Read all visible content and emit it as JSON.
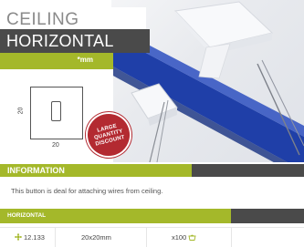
{
  "header": {
    "title_line1": "CEILING",
    "title_line2": "HORIZONTAL CLIP"
  },
  "dimensions": {
    "unit_label": "*mm",
    "height_label": "20",
    "width_label": "20"
  },
  "badge": {
    "line1": "LARGE",
    "line2": "QUANTITY",
    "line3": "DISCOUNT"
  },
  "info": {
    "heading": "INFORMATION",
    "text": "This button is deal for attaching wires from ceiling."
  },
  "table": {
    "header": "HORIZONTAL",
    "rows": [
      {
        "code": "12.133",
        "code_icon": "reference-icon",
        "size": "20x20mm",
        "qty": "x100",
        "qty_icon": "bag-icon"
      }
    ]
  },
  "colors": {
    "accent_green": "#a4b82a",
    "dark_gray": "#4a4a4a",
    "badge_red": "#b32a31",
    "cable_blue": "#1f3fa8"
  }
}
